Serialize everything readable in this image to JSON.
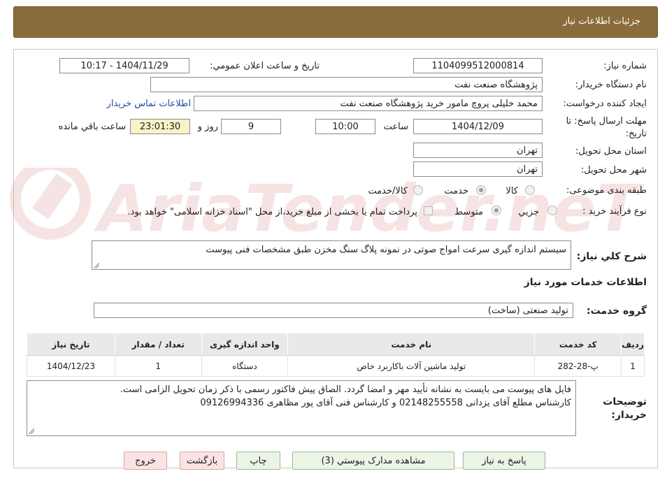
{
  "header": {
    "title": "جزئیات اطلاعات نیاز"
  },
  "fields": {
    "need_number_label": "شماره نیاز:",
    "need_number": "1104099512000814",
    "announce_label": "تاریخ و ساعت اعلان عمومي:",
    "announce_value": "1404/11/29 - 10:17",
    "buyer_label": "نام دستگاه خریدار:",
    "buyer_value": "پژوهشگاه صنعت نفت",
    "requester_label": "ایجاد کننده درخواست:",
    "requester_value": "محمد خلیلی پروچ مامور خرید پژوهشگاه صنعت نفت",
    "contact_link": "اطلاعات تماس خریدار",
    "deadline_label_1": "مهلت ارسال پاسخ: تا",
    "deadline_label_2": "تاریخ:",
    "deadline_date": "1404/12/09",
    "time_label": "ساعت",
    "deadline_time": "10:00",
    "days": "9",
    "days_label": "روز و",
    "remaining_time": "23:01:30",
    "remaining_label": "ساعت باقي مانده",
    "province_label": "استان محل تحویل:",
    "province_value": "تهران",
    "city_label": "شهر محل تحویل:",
    "city_value": "تهران",
    "category_label": "طبقه بندی موضوعی:",
    "category_options": [
      "کالا",
      "خدمت",
      "کالا/خدمت"
    ],
    "category_selected": "خدمت",
    "process_label": "نوع فرآیند خرید :",
    "process_options": [
      "جزيي",
      "متوسط"
    ],
    "process_selected": "متوسط",
    "payment_note": "پرداخت تمام یا بخشی از مبلغ خرید،از محل \"اسناد خزانه اسلامی\" خواهد بود.",
    "general_desc_label": "شرح كلي نياز:",
    "general_desc_value": "سیستم اندازه گیری سرعت امواج صوتی در نمونه پلاگ سنگ مخزن طبق مشخصات فنی پیوست",
    "services_title": "اطلاعات خدمات مورد نياز",
    "service_group_label": "گروه خدمت:",
    "service_group_value": "تولید صنعتی (ساخت)"
  },
  "table": {
    "headers": [
      "رديف",
      "كد خدمت",
      "نام خدمت",
      "واحد اندازه گيری",
      "تعداد / مقدار",
      "تاريخ نياز"
    ],
    "rows": [
      [
        "1",
        "پ-28-282",
        "تولید ماشین آلات باکاربرد خاص",
        "دستگاه",
        "1",
        "1404/12/23"
      ]
    ]
  },
  "buyer_notes_label_1": "توضیحات",
  "buyer_notes_label_2": "خریدار:",
  "buyer_notes_line1": "فایل های پیوست می بایست به نشانه تأیید مهر و امضا گردد. الصاق پیش فاکتور رسمی با ذکر زمان تحویل الزامی است.",
  "buyer_notes_line2": "کارشناس مطلع آقای یزدانی 02148255558 و کارشناس فنی آقای پور مظاهری 09126994336",
  "buttons": {
    "reply": "پاسخ به نياز",
    "attachments": "مشاهده مدارک پیوستي (3)",
    "print": "چاپ",
    "back": "بازگشت",
    "exit": "خروج"
  },
  "watermark_text": "AriaTender.neT",
  "colors": {
    "header_bg": "#8a6d3b",
    "link": "#1a4fa3",
    "remaining_bg": "#f6f3c6"
  }
}
